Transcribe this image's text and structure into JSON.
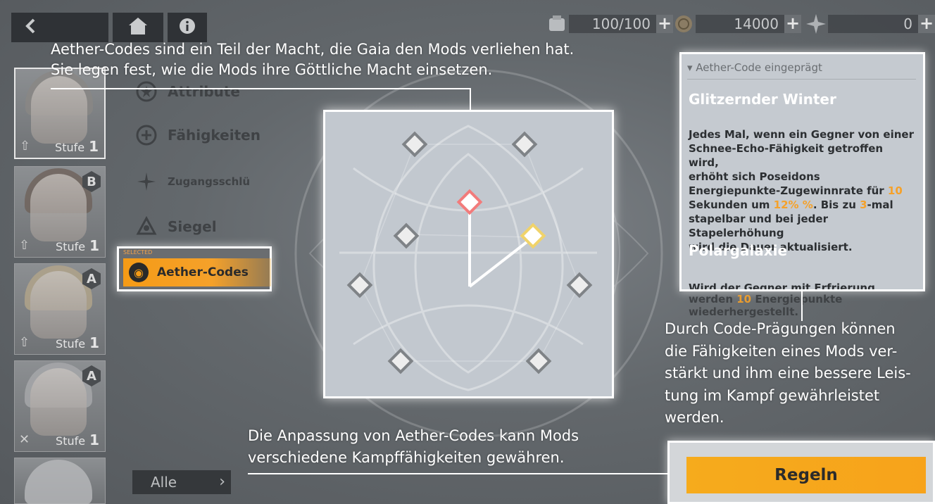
{
  "colors": {
    "accent": "#f59b16",
    "highlight": "#f5a12a",
    "node_active_red": "#f27b7b",
    "node_active_yellow": "#f0d36a"
  },
  "topbar": {
    "back_icon": "chevron-left-icon",
    "home_icon": "home-icon",
    "info_icon": "info-icon",
    "resources": [
      {
        "icon": "energy-icon",
        "value": "100/100"
      },
      {
        "icon": "coin-icon",
        "value": "14000"
      },
      {
        "icon": "crystal-icon",
        "value": "0"
      }
    ],
    "plus": "+"
  },
  "characters": [
    {
      "stufe_label": "Stufe",
      "level": "1",
      "rank": ""
    },
    {
      "stufe_label": "Stufe",
      "level": "1",
      "rank": "B"
    },
    {
      "stufe_label": "Stufe",
      "level": "1",
      "rank": "A"
    },
    {
      "stufe_label": "Stufe",
      "level": "1",
      "rank": "A"
    },
    {
      "stufe_label": "",
      "level": "",
      "rank": ""
    }
  ],
  "menu": {
    "attribute": "Attribute",
    "faehigkeiten": "Fähigkeiten",
    "zugang": "Zugangsschlü",
    "siegel": "Siegel",
    "aether": "Aether-Codes",
    "selected_tag": "SELECTED"
  },
  "filter": {
    "label": "Alle"
  },
  "tips": {
    "top_line1": "Aether-Codes sind ein Teil der Macht, die Gaia den Mods verliehen hat.",
    "top_line2": "Sie legen fest, wie die Mods ihre Göttliche Macht einsetzen.",
    "right_lines": [
      "Durch Code-Prägungen können",
      "die Fähigkeiten eines Mods ver-",
      "stärkt und ihm eine bessere Leis-",
      "tung im Kampf gewährleistet",
      "werden."
    ],
    "bottom_line1": "Die Anpassung von Aether-Codes kann Mods",
    "bottom_line2": "verschiedene Kampffähigkeiten gewähren."
  },
  "panel": {
    "header": "▾ Aether-Code eingeprägt",
    "title1": "Glitzernder Winter",
    "desc1": {
      "l1": "Jedes Mal, wenn ein Gegner von einer",
      "l2": "Schnee-Echo-Fähigkeit getroffen wird,",
      "l3": "erhöht sich Poseidons",
      "l4a": "Energiepunkte-Zugewinnrate für ",
      "l4b": "10",
      "l5a": "Sekunden um ",
      "l5b": "12% %",
      "l5c": ". Bis zu ",
      "l5d": "3",
      "l5e": "-mal",
      "l6": "stapelbar und bei jeder Stapelerhöhung",
      "l7": "wird die Dauer aktualisiert."
    },
    "title2": "Polargalaxie",
    "desc2": {
      "l1": "Wird der Gegner mit Erfrierung belegt,",
      "l2a": "werden ",
      "l2b": "10",
      "l2c": " Energiepunkte",
      "l3": "wiederhergestellt."
    }
  },
  "rules_button": "Regeln"
}
